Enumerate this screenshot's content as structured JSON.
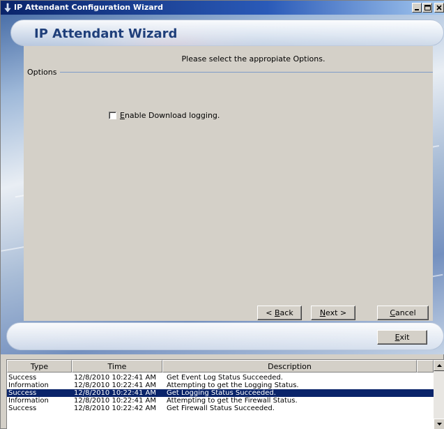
{
  "window": {
    "title": "IP Attendant Configuration Wizard"
  },
  "header": {
    "title": "IP Attendant Wizard"
  },
  "panel": {
    "instruction": "Please select the appropiate Options.",
    "group_label": "Options",
    "checkbox": {
      "label_mnemonic": "E",
      "label_rest": "nable Download logging.",
      "checked": false
    }
  },
  "buttons": {
    "back": {
      "prefix": "< ",
      "mnemonic": "B",
      "rest": "ack"
    },
    "next": {
      "mnemonic": "N",
      "rest": "ext >"
    },
    "cancel": {
      "mnemonic": "C",
      "rest": "ancel"
    },
    "exit": {
      "mnemonic": "E",
      "rest": "xit"
    }
  },
  "log": {
    "columns": [
      "Type",
      "Time",
      "Description"
    ],
    "rows": [
      {
        "type": "Success",
        "time": "12/8/2010 10:22:41 AM",
        "description": "Get Event Log Status Succeeded.",
        "selected": false
      },
      {
        "type": "Information",
        "time": "12/8/2010 10:22:41 AM",
        "description": "Attempting to get the Logging Status.",
        "selected": false
      },
      {
        "type": "Success",
        "time": "12/8/2010 10:22:41 AM",
        "description": "Get Logging Status Succeeded.",
        "selected": true
      },
      {
        "type": "Information",
        "time": "12/8/2010 10:22:41 AM",
        "description": "Attempting to get the Firewall Status.",
        "selected": false
      },
      {
        "type": "Success",
        "time": "12/8/2010 10:22:42 AM",
        "description": "Get Firewall Status Succeeded.",
        "selected": false
      }
    ]
  },
  "colors": {
    "titlebar_start": "#0a246a",
    "selection": "#0a246a",
    "header_text": "#1f3f7a",
    "dialog_face": "#d4d0c8"
  },
  "icons": [
    "app-icon",
    "minimize-icon",
    "maximize-icon",
    "close-icon",
    "scroll-up-icon",
    "scroll-down-icon"
  ]
}
